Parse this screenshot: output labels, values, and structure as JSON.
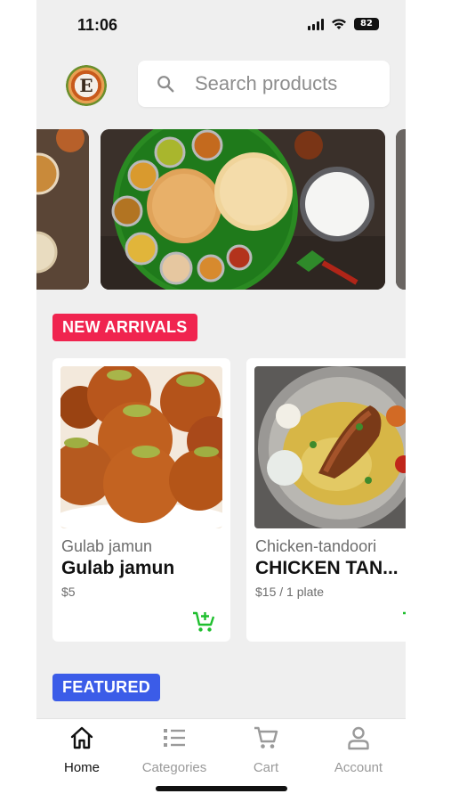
{
  "status_bar": {
    "time": "11:06",
    "battery": "82"
  },
  "header": {
    "logo_letter": "E"
  },
  "search": {
    "placeholder": "Search products"
  },
  "sections": {
    "new_arrivals": "NEW ARRIVALS",
    "featured": "FEATURED"
  },
  "products": [
    {
      "category": "Gulab jamun",
      "name": "Gulab jamun",
      "price": "$5"
    },
    {
      "category": "Chicken-tandoori",
      "name": "CHICKEN TAN...",
      "price": "$15 / 1 plate"
    }
  ],
  "nav": {
    "items": [
      {
        "label": "Home",
        "icon": "home-icon",
        "active": true
      },
      {
        "label": "Categories",
        "icon": "categories-icon",
        "active": false
      },
      {
        "label": "Cart",
        "icon": "cart-icon",
        "active": false
      },
      {
        "label": "Account",
        "icon": "account-icon",
        "active": false
      }
    ]
  },
  "colors": {
    "new_arrivals_badge": "#f0244f",
    "featured_badge": "#3b5ce8",
    "cart_add_icon": "#1fbf2e",
    "background": "#efefef"
  }
}
